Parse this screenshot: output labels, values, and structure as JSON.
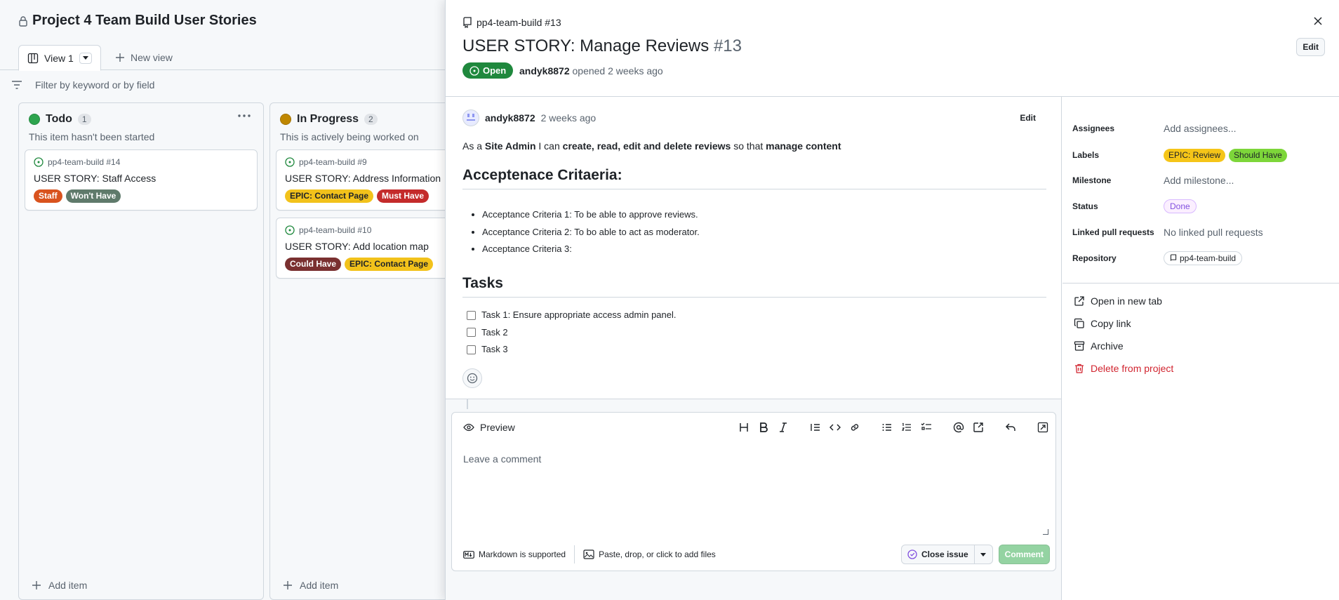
{
  "project": {
    "title": "Project 4 Team Build User Stories",
    "tab_view": "View 1",
    "new_view": "New view",
    "filter_placeholder": "Filter by keyword or by field"
  },
  "columns": [
    {
      "name": "Todo",
      "count": "1",
      "color": "#2da44e",
      "description": "This item hasn't been started",
      "add_item": "Add item",
      "cards": [
        {
          "repo": "pp4-team-build #14",
          "title": "USER STORY: Staff Access",
          "labels": [
            {
              "text": "Staff",
              "bg": "#d9531e",
              "fg": "#ffffff"
            },
            {
              "text": "Won't Have",
              "bg": "#5f7a6b",
              "fg": "#ffffff"
            }
          ]
        }
      ]
    },
    {
      "name": "In Progress",
      "count": "2",
      "color": "#bf8700",
      "description": "This is actively being worked on",
      "add_item": "Add item",
      "cards": [
        {
          "repo": "pp4-team-build #9",
          "title": "USER STORY: Address Information",
          "labels": [
            {
              "text": "EPIC: Contact Page",
              "bg": "#f2c21b",
              "fg": "#1f2328"
            },
            {
              "text": "Must Have",
              "bg": "#c42b2b",
              "fg": "#ffffff"
            }
          ]
        },
        {
          "repo": "pp4-team-build #10",
          "title": "USER STORY: Add location map",
          "labels": [
            {
              "text": "Could Have",
              "bg": "#7a3030",
              "fg": "#ffffff"
            },
            {
              "text": "EPIC: Contact Page",
              "bg": "#f2c21b",
              "fg": "#1f2328"
            }
          ]
        }
      ]
    }
  ],
  "panel": {
    "repo_ref": "pp4-team-build #13",
    "title": "USER STORY: Manage Reviews",
    "number": "#13",
    "edit": "Edit",
    "state": "Open",
    "author": "andyk8872",
    "opened_text": "opened 2 weeks ago",
    "comment": {
      "author": "andyk8872",
      "ago": "2 weeks ago",
      "edit": "Edit",
      "story": {
        "p1": "As a ",
        "b1": "Site Admin",
        "p2": " I can ",
        "b2": "create, read, edit and delete reviews",
        "p3": " so that ",
        "b3": "manage content"
      },
      "criteria_heading": "Acceptenace Critaeria:",
      "criteria": [
        "Acceptance Criteria 1: To be able to approve reviews.",
        "Acceptance Criteria 2: To bo able to act as moderator.",
        "Acceptance Criteria 3:"
      ],
      "tasks_heading": "Tasks",
      "tasks": [
        "Task 1: Ensure appropriate access admin panel.",
        "Task 2",
        "Task 3"
      ]
    },
    "editor": {
      "preview_tab": "Preview",
      "placeholder": "Leave a comment",
      "markdown_note": "Markdown is supported",
      "attach_note": "Paste, drop, or click to add files",
      "close_issue": "Close issue",
      "comment_button": "Comment"
    },
    "fields": {
      "assignees_label": "Assignees",
      "assignees_value": "Add assignees...",
      "labels_label": "Labels",
      "labels": [
        {
          "text": "EPIC: Review",
          "bg": "#f5c518",
          "fg": "#1f2328"
        },
        {
          "text": "Should Have",
          "bg": "#7dd63a",
          "fg": "#1f2328"
        }
      ],
      "milestone_label": "Milestone",
      "milestone_value": "Add milestone...",
      "status_label": "Status",
      "status_value": "Done",
      "linked_label": "Linked pull requests",
      "linked_value": "No linked pull requests",
      "repository_label": "Repository",
      "repository_value": "pp4-team-build"
    },
    "actions": {
      "open_new_tab": "Open in new tab",
      "copy_link": "Copy link",
      "archive": "Archive",
      "delete": "Delete from project"
    }
  }
}
